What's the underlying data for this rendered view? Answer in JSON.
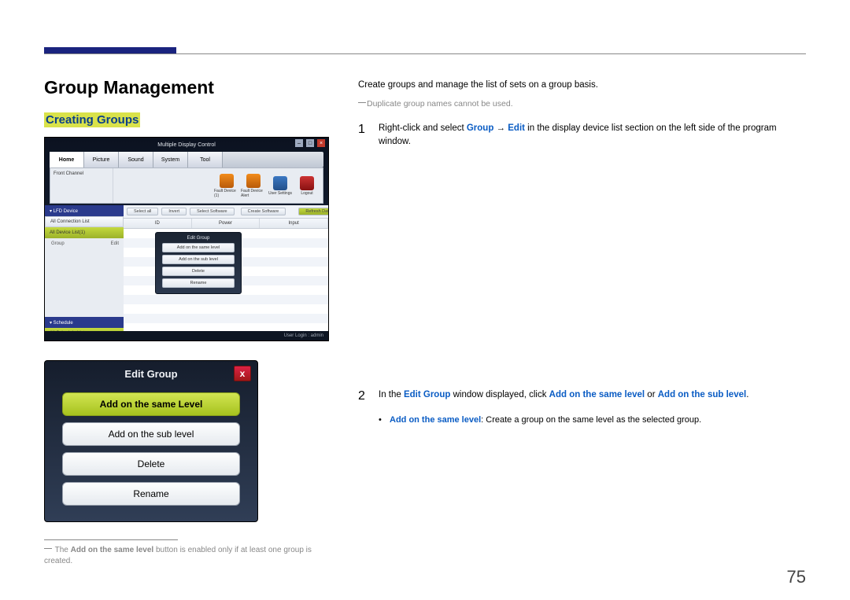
{
  "page": {
    "number": "75"
  },
  "heading": "Group Management",
  "subheading": "Creating Groups",
  "screenshot1": {
    "window_title": "Multiple Display Control",
    "tabs": [
      "Home",
      "Picture",
      "Sound",
      "System",
      "Tool"
    ],
    "ribbon_left": "Front\nChannel",
    "ribbon_icons": [
      {
        "name": "fault-device-icon",
        "label": "Fault Device (1)"
      },
      {
        "name": "fault-device-alert-icon",
        "label": "Fault Device Alert"
      },
      {
        "name": "user-settings-icon",
        "label": "User Settings"
      },
      {
        "name": "logout-icon",
        "label": "Logout"
      }
    ],
    "sidebar": {
      "head1": "▾ LFD Device",
      "pill": "All Connection List",
      "green": "All Device List(1)",
      "row_left": "Group",
      "row_right": "Edit",
      "head2": "▾ Schedule",
      "pill2": "All Schedule List"
    },
    "btnrow": [
      "Select all",
      "Invert",
      "Select Software",
      "",
      "Create Software",
      "",
      "Refresh Data"
    ],
    "cols": [
      "ID",
      "Power",
      "Input"
    ],
    "popup": {
      "title": "Edit Group",
      "b1": "Add on the same level",
      "b2": "Add on the sub level",
      "b3": "Delete",
      "b4": "Rename"
    },
    "footer": "User Login : admin"
  },
  "screenshot2": {
    "title": "Edit Group",
    "b1": "Add on the same Level",
    "b2": "Add on the sub level",
    "b3": "Delete",
    "b4": "Rename",
    "close": "x"
  },
  "footnote": {
    "prefix": "The ",
    "bold": "Add on the same level",
    "suffix": " button is enabled only if at least one group is created."
  },
  "right": {
    "intro": "Create groups and manage the list of sets on a group basis.",
    "note": "Duplicate group names cannot be used.",
    "step1": {
      "num": "1",
      "pre": "Right-click and select ",
      "b1": "Group",
      "arrow": " → ",
      "b2": "Edit",
      "post": " in the display device list section on the left side of the program window."
    },
    "step2": {
      "num": "2",
      "pre": "In the ",
      "b1": "Edit Group",
      "mid": " window displayed, click ",
      "b2": "Add on the same level",
      "or": " or ",
      "b3": "Add on the sub level",
      "period": "."
    },
    "bullet": {
      "dot": "•",
      "b": "Add on the same level",
      "rest": ": Create a group on the same level as the selected group."
    }
  }
}
